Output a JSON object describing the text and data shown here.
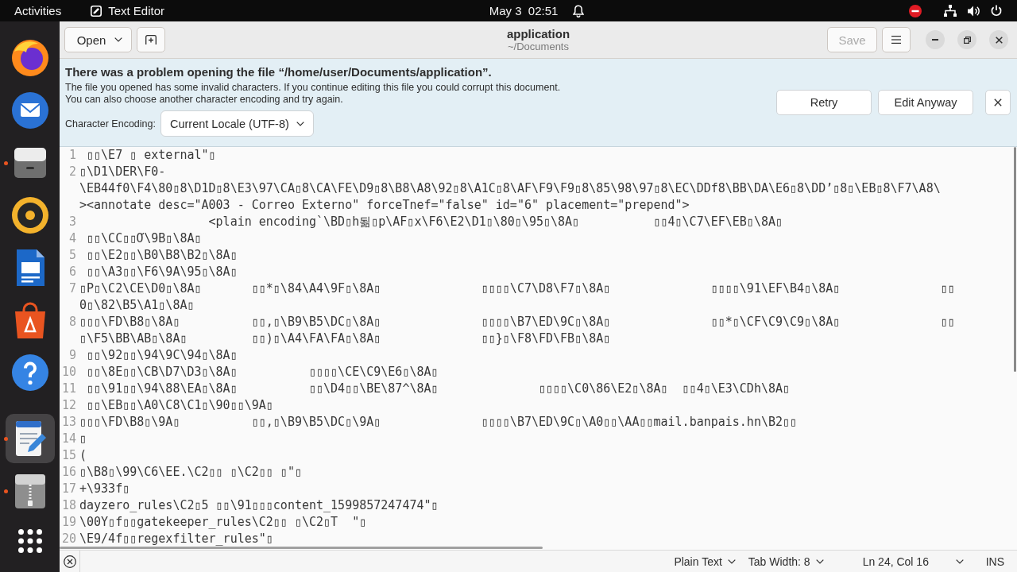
{
  "top_bar": {
    "activities": "Activities",
    "app_name": "Text Editor",
    "clock": "May 3  02:51"
  },
  "dock": {
    "pinned": [
      {
        "running": false,
        "selected": false
      },
      {
        "running": false,
        "selected": false
      },
      {
        "running": true,
        "selected": false
      },
      {
        "running": false,
        "selected": false
      },
      {
        "running": false,
        "selected": false
      },
      {
        "running": false,
        "selected": false
      },
      {
        "running": false,
        "selected": false
      }
    ],
    "others": [
      {
        "running": true,
        "selected": true
      },
      {
        "running": true,
        "selected": false
      }
    ]
  },
  "header": {
    "open_button": "Open",
    "title": "application",
    "subtitle": "~/Documents",
    "save_button": {
      "label": "Save",
      "disabled": true
    }
  },
  "info_bar": {
    "title": "There was a problem opening the file “/home/user/Documents/application”.",
    "message": [
      "The file you opened has some invalid characters. If you continue editing this file you could corrupt this document.",
      "You can also choose another character encoding and try again."
    ],
    "encoding_label": "Character Encoding:",
    "encoding": "Current Locale (UTF-8)",
    "buttons": [
      "Retry",
      "Edit Anyway"
    ]
  },
  "editor": {
    "lines": [
      {
        "number": "1",
        "rows": [
          " ▯▯\\E7 ▯ external\"▯"
        ]
      },
      {
        "number": "2",
        "rows": [
          "▯\\D1\\DER\\F0-",
          "\\EB44f0\\F4\\80▯8\\D1D▯8\\E3\\97\\CA▯8\\CA\\FE\\D9▯8\\B8\\A8\\92▯8\\A1C▯8\\AF\\F9\\F9▯8\\85\\98\\97▯8\\EC\\DDf8\\BB\\DA\\E6▯8\\DD’▯8▯\\EB▯8\\F7\\A8\\",
          "><annotate desc=\"A003 - Correo Externo\" forceTnef=\"false\" id=\"6\" placement=\"prepend\">"
        ]
      },
      {
        "number": "3",
        "rows": [
          "\t\t  <plain encoding`\\BD▯h됢▯p\\AF▯x\\F6\\E2\\D1▯\\80▯\\95▯\\8A▯\t\t▯▯4▯\\C7\\EF\\EB▯\\8A▯"
        ]
      },
      {
        "number": "4",
        "rows": [
          " ▯▯\\CC▯▯Ơ\\9B▯\\8A▯"
        ]
      },
      {
        "number": "5",
        "rows": [
          " ▯▯\\E2▯▯\\B0\\B8\\B2▯\\8A▯"
        ]
      },
      {
        "number": "6",
        "rows": [
          " ▯▯\\A3▯▯\\F6\\9A\\95▯\\8A▯"
        ]
      },
      {
        "number": "7",
        "rows": [
          "▯P▯\\C2\\CE\\D0▯\\8A▯\t▯▯*▯\\84\\A4\\9F▯\\8A▯\t\t▯▯▯▯\\C7\\D8\\F7▯\\8A▯\t\t▯▯▯▯\\91\\EF\\B4▯\\8A▯\t\t▯▯",
          "0▯\\82\\B5\\A1▯\\8A▯"
        ]
      },
      {
        "number": "8",
        "rows": [
          "▯▯▯\\FD\\B8▯\\8A▯\t\t▯▯,▯\\B9\\B5\\DC▯\\8A▯\t\t▯▯▯▯\\B7\\ED\\9C▯\\8A▯\t\t▯▯*▯\\CF\\C9\\C9▯\\8A▯\t\t▯▯",
          "▯\\F5\\BB\\AB▯\\8A▯\t\t▯▯)▯\\A4\\FA\\FA▯\\8A▯\t\t▯▯}▯\\F8\\FD\\FB▯\\8A▯"
        ]
      },
      {
        "number": "9",
        "rows": [
          " ▯▯\\92▯▯\\94\\9C\\94▯\\8A▯"
        ]
      },
      {
        "number": "10",
        "rows": [
          " ▯▯\\8E▯▯\\CB\\D7\\D3▯\\8A▯\t\t▯▯▯▯\\CE\\C9\\E6▯\\8A▯"
        ]
      },
      {
        "number": "11",
        "rows": [
          " ▯▯\\91▯▯\\94\\88\\EA▯\\8A▯\t\t▯▯\\D4▯▯\\BE\\87^\\8A▯\t\t▯▯▯▯\\C0\\86\\E2▯\\8A▯  ▯▯4▯\\E3\\CDh\\8A▯"
        ]
      },
      {
        "number": "12",
        "rows": [
          " ▯▯\\EB▯▯\\A0\\C8\\C1▯\\90▯▯\\9A▯"
        ]
      },
      {
        "number": "13",
        "rows": [
          "▯▯▯\\FD\\B8▯\\9A▯\t\t▯▯,▯\\B9\\B5\\DC▯\\9A▯\t\t▯▯▯▯\\B7\\ED\\9C▯\\A0▯▯\\AA▯▯mail.banpais.hn\\B2▯▯"
        ]
      },
      {
        "number": "14",
        "rows": [
          "▯"
        ]
      },
      {
        "number": "15",
        "rows": [
          "("
        ]
      },
      {
        "number": "16",
        "rows": [
          "▯\\B8▯\\99\\C6\\EE.\\C2▯▯ ▯\\C2▯▯ ▯\"▯"
        ]
      },
      {
        "number": "17",
        "rows": [
          "+\\933f▯"
        ]
      },
      {
        "number": "18",
        "rows": [
          "dayzero_rules\\C2▯5 ▯▯\\91▯▯▯content_1599857247474\"▯"
        ]
      },
      {
        "number": "19",
        "rows": [
          "\\00Y▯f▯▯gatekeeper_rules\\C2▯▯ ▯\\C2▯T  \"▯"
        ]
      },
      {
        "number": "20",
        "rows": [
          "\\E9/4f▯▯regexfilter_rules\"▯"
        ]
      }
    ]
  },
  "status_bar": {
    "language": "Plain Text",
    "tab_width": "Tab Width: 8",
    "position": "Ln 24, Col 16",
    "mode": "INS"
  }
}
